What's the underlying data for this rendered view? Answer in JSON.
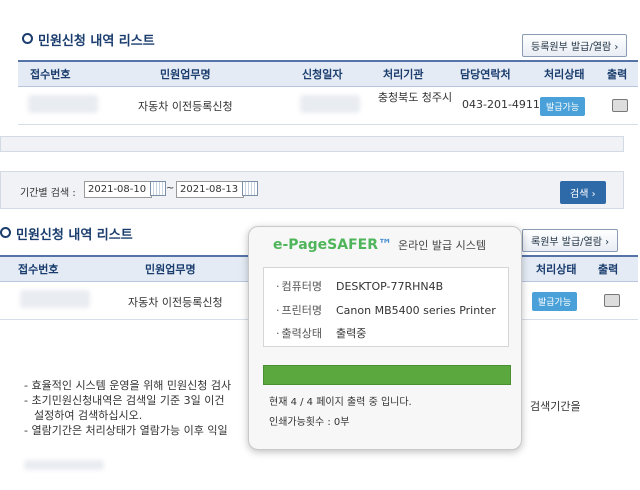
{
  "top": {
    "title": "민원신청 내역 리스트",
    "issue_button": "등록원부 발급/열람 ›",
    "columns": [
      "접수번호",
      "민원업무명",
      "신청일자",
      "처리기관",
      "담당연락처",
      "처리상태",
      "출력"
    ],
    "rows": [
      {
        "task": "자동차 이전등록신청",
        "agency": "충청북도 청주시",
        "contact": "043-201-4911",
        "status": "발급가능"
      }
    ]
  },
  "filter": {
    "label": "기간별 검색 :",
    "date_from": "2021-08-10",
    "tilde": "~",
    "date_to": "2021-08-13",
    "search_button": "검색 ›"
  },
  "bottom": {
    "title": "민원신청 내역 리스트",
    "issue_button": "록원부 발급/열람 ›",
    "columns": [
      "접수번호",
      "민원업무명",
      "처리상태",
      "출력"
    ],
    "rows": [
      {
        "task": "자동차 이전등록신청",
        "status": "발급가능"
      }
    ]
  },
  "notes": [
    "- 효율적인 시스템 운영을 위해 민원신청 검사",
    "- 초기민원신청내역은 검색일 기준 3일 이건",
    "설정하여 검색하십시오.",
    "- 열람기간은 처리상태가 열람가능 이후 익일",
    "검색기간을"
  ],
  "dialog": {
    "brand": "e-PageSAFER",
    "tm": "™",
    "subtitle": "온라인 발급 시스템",
    "computer_label": "컴퓨터명",
    "computer_value": "DESKTOP-77RHN4B",
    "printer_label": "프린터명",
    "printer_value": "Canon MB5400 series Printer",
    "status_label": "출력상태",
    "status_value": "출력중",
    "progress": 1.0,
    "page_status": "현재 4 / 4 페이지 출력 중 입니다.",
    "print_count": "인쇄가능횟수 : 0부"
  }
}
